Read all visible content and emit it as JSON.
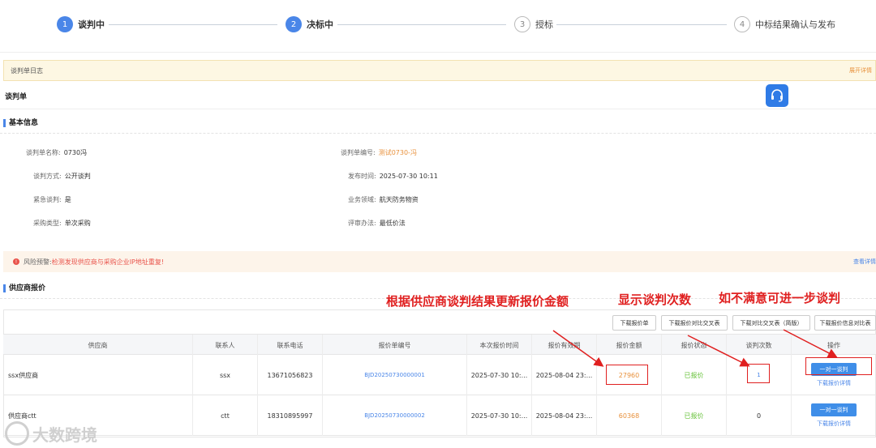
{
  "steps": [
    {
      "num": "1",
      "label": "谈判中"
    },
    {
      "num": "2",
      "label": "决标中"
    },
    {
      "num": "3",
      "label": "授标"
    },
    {
      "num": "4",
      "label": "中标结果确认与发布"
    }
  ],
  "log": {
    "title": "谈判单日志",
    "expand": "展开详情"
  },
  "page_title": "谈判单",
  "basic": {
    "title": "基本信息",
    "fields": [
      {
        "label": "谈判单名称:",
        "value": "0730冯"
      },
      {
        "label": "谈判单编号:",
        "value": "测试0730-冯"
      },
      {
        "label": "谈判方式:",
        "value": "公开谈判"
      },
      {
        "label": "发布时间:",
        "value": "2025-07-30 10:11"
      },
      {
        "label": "紧急谈判:",
        "value": "是"
      },
      {
        "label": "业务领域:",
        "value": "航天防务物资"
      },
      {
        "label": "采购类型:",
        "value": "单次采购"
      },
      {
        "label": "评审办法:",
        "value": "最低价法"
      }
    ]
  },
  "risk": {
    "icon": "!",
    "prefix": "风险预警:",
    "message": "检测发现供应商与采购企业IP地址重复!",
    "view": "查看详情"
  },
  "quote_section": {
    "title": "供应商报价"
  },
  "toolbar": [
    "下载报价单",
    "下载报价对比交叉表",
    "下载对比交叉表（简版）",
    "下载报价信息对比表"
  ],
  "table": {
    "headers": [
      "供应商",
      "联系人",
      "联系电话",
      "报价单编号",
      "本次报价时间",
      "报价有效期",
      "报价金额",
      "报价状态",
      "谈判次数",
      "操作"
    ],
    "rows": [
      {
        "supplier": "ssx供应商",
        "contact": "ssx",
        "phone": "13671056823",
        "code": "BJD20250730000001",
        "time": "2025-07-30 10:...",
        "valid": "2025-08-04 23:...",
        "amount": "27960",
        "status": "已报价",
        "rounds": "1",
        "btn": "一对一谈判",
        "link": "下载报价详情"
      },
      {
        "supplier": "供应商ctt",
        "contact": "ctt",
        "phone": "18310895997",
        "code": "BJD20250730000002",
        "time": "2025-07-30 10:...",
        "valid": "2025-08-04 23:...",
        "amount": "60368",
        "status": "已报价",
        "rounds": "0",
        "btn": "一对一谈判",
        "link": "下载报价详情"
      }
    ]
  },
  "annotations": [
    "根据供应商谈判结果更新报价金额",
    "显示谈判次数",
    "如不满意可进一步谈判"
  ],
  "watermark": "大数跨境",
  "colors": {
    "accent": "#4a86e8",
    "annotation": "#e02020",
    "orange": "#e8913c",
    "green": "#67c23a"
  }
}
